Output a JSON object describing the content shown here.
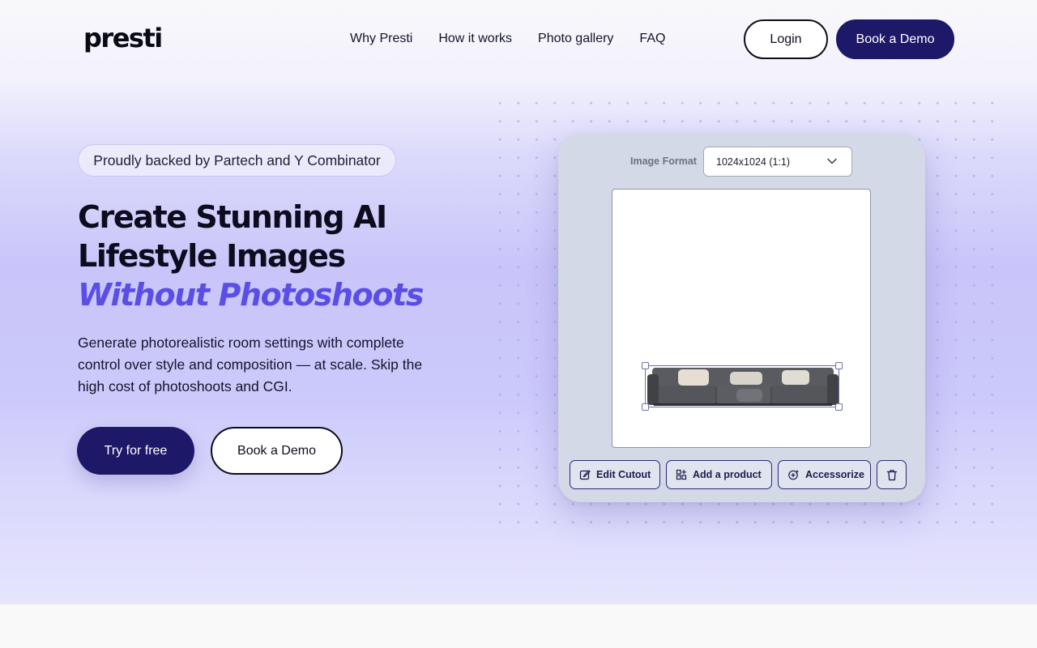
{
  "brand": {
    "logo": "presti"
  },
  "nav": {
    "links": [
      "Why Presti",
      "How it works",
      "Photo gallery",
      "FAQ"
    ],
    "login_label": "Login",
    "demo_label": "Book a Demo"
  },
  "hero": {
    "badge": "Proudly backed by Partech and Y Combinator",
    "headline_line1": "Create Stunning AI",
    "headline_line2": "Lifestyle Images",
    "headline_accent": "Without Photoshoots",
    "subtext": "Generate photorealistic room settings with complete control over style and composition — at scale. Skip the high cost of photoshoots and CGI.",
    "cta_primary": "Try for free",
    "cta_secondary": "Book a Demo"
  },
  "editor": {
    "format_label": "Image Format",
    "format_value": "1024x1024 (1:1)",
    "tools": [
      {
        "label": "Edit Cutout",
        "icon": "edit-icon"
      },
      {
        "label": "Add a product",
        "icon": "add-product-icon"
      },
      {
        "label": "Accessorize",
        "icon": "accessorize-icon"
      }
    ],
    "delete_icon": "trash-icon"
  },
  "colors": {
    "brand_navy": "#1e1868",
    "accent_purple": "#5a4ee6",
    "hero_gradient": "#c9c5fa",
    "card_bg": "#d3d9e6"
  }
}
